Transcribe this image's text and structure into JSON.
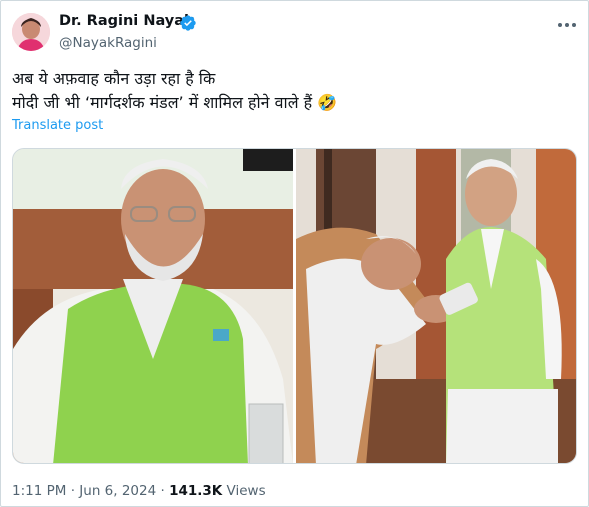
{
  "author": {
    "display_name": "Dr. Ragini Nayak",
    "handle": "@NayakRagini",
    "avatar_icon": "profile-photo",
    "verified_icon": "verified-badge-icon"
  },
  "tweet": {
    "line1": "अब ये अफ़वाह कौन उड़ा रहा है कि",
    "line2": "मोदी जी भी ‘मार्गदर्शक मंडल’ में शामिल होने वाले हैं 🤣",
    "translate_label": "Translate post"
  },
  "meta": {
    "time": "1:11 PM",
    "separator": " · ",
    "date": "Jun 6, 2024",
    "views_count": "141.3K",
    "views_label": " Views"
  },
  "colors": {
    "link": "#1d9bf0",
    "verified": "#1d9bf0",
    "secondary_text": "#536471"
  }
}
